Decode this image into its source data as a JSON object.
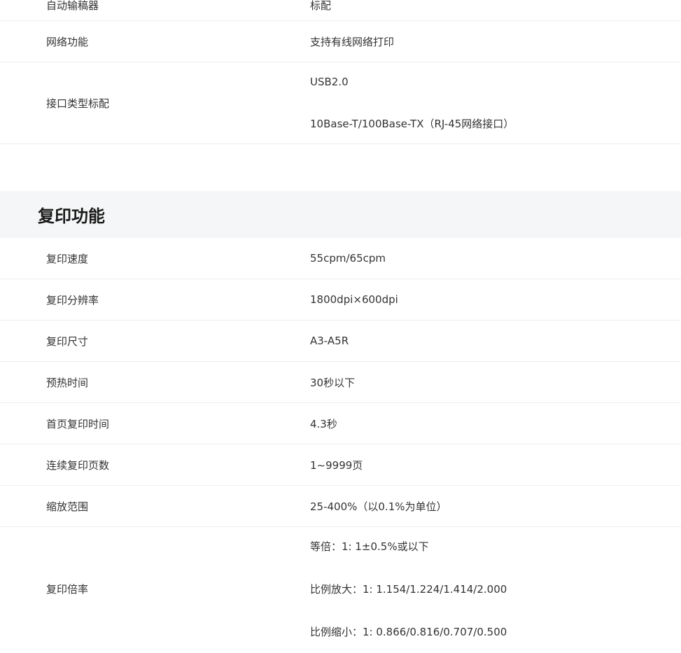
{
  "section1": {
    "rows": [
      {
        "label": "自动输稿器",
        "values": [
          "标配"
        ]
      },
      {
        "label": "网络功能",
        "values": [
          "支持有线网络打印"
        ]
      },
      {
        "label": "接口类型标配",
        "values": [
          "USB2.0",
          "10Base-T/100Base-TX（RJ-45网络接口）"
        ]
      }
    ]
  },
  "section2": {
    "title": "复印功能",
    "rows": [
      {
        "label": "复印速度",
        "values": [
          "55cpm/65cpm"
        ]
      },
      {
        "label": "复印分辨率",
        "values": [
          "1800dpi×600dpi"
        ]
      },
      {
        "label": "复印尺寸",
        "values": [
          "A3-A5R"
        ]
      },
      {
        "label": "预热时间",
        "values": [
          "30秒以下"
        ]
      },
      {
        "label": "首页复印时间",
        "values": [
          "4.3秒"
        ]
      },
      {
        "label": "连续复印页数",
        "values": [
          "1~9999页"
        ]
      },
      {
        "label": "缩放范围",
        "values": [
          "25-400%（以0.1%为单位）"
        ]
      },
      {
        "label": "复印倍率",
        "values": [
          "等倍：1: 1±0.5%或以下",
          "比例放大：1: 1.154/1.224/1.414/2.000",
          "比例缩小：1: 0.866/0.816/0.707/0.500"
        ]
      }
    ]
  }
}
